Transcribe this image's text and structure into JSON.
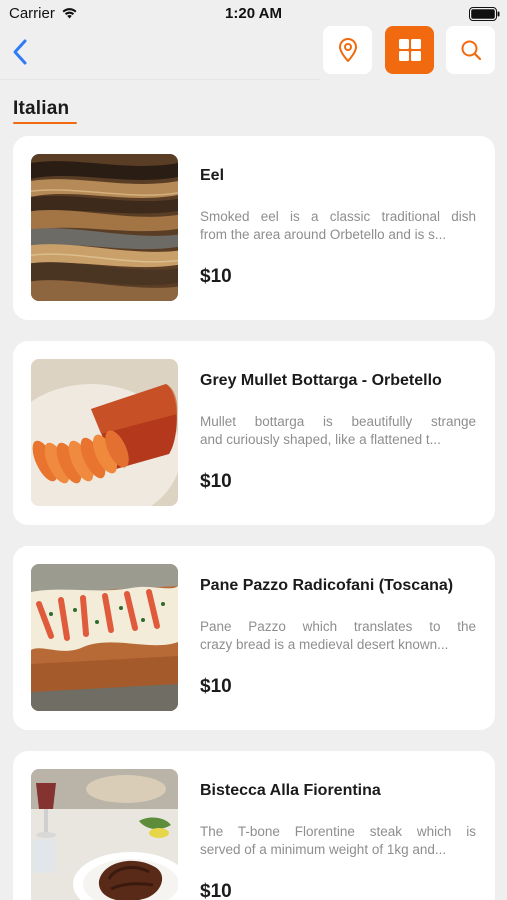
{
  "status_bar": {
    "carrier": "Carrier",
    "time": "1:20 AM"
  },
  "nav": {
    "back_icon": "chevron-left-icon",
    "actions": [
      {
        "icon": "location-pin-icon",
        "active": false
      },
      {
        "icon": "grid-icon",
        "active": true
      },
      {
        "icon": "search-icon",
        "active": false
      }
    ]
  },
  "category": {
    "title": "Italian"
  },
  "colors": {
    "accent": "#f26a0f",
    "back": "#2f7cf6",
    "background": "#efefef",
    "card": "#ffffff",
    "text": "#1b1b1b",
    "muted": "#8e8e8e"
  },
  "items": [
    {
      "title": "Eel",
      "desc_line1": "Smoked eel is a classic traditional dish",
      "desc_line2": "from the area around Orbetello and is s...",
      "price": "$10"
    },
    {
      "title": "Grey Mullet Bottarga - Orbetello",
      "desc_line1": "Mullet bottarga is beautifully strange",
      "desc_line2": "and curiously shaped, like a flattened t...",
      "price": "$10"
    },
    {
      "title": "Pane Pazzo Radicofani (Toscana)",
      "desc_line1": "Pane Pazzo which translates to the",
      "desc_line2": "crazy bread is a medieval desert known...",
      "price": "$10"
    },
    {
      "title": "Bistecca Alla Fiorentina",
      "desc_line1": "The T-bone Florentine steak which is",
      "desc_line2": "served of a minimum weight of 1kg and...",
      "price": "$10"
    }
  ]
}
